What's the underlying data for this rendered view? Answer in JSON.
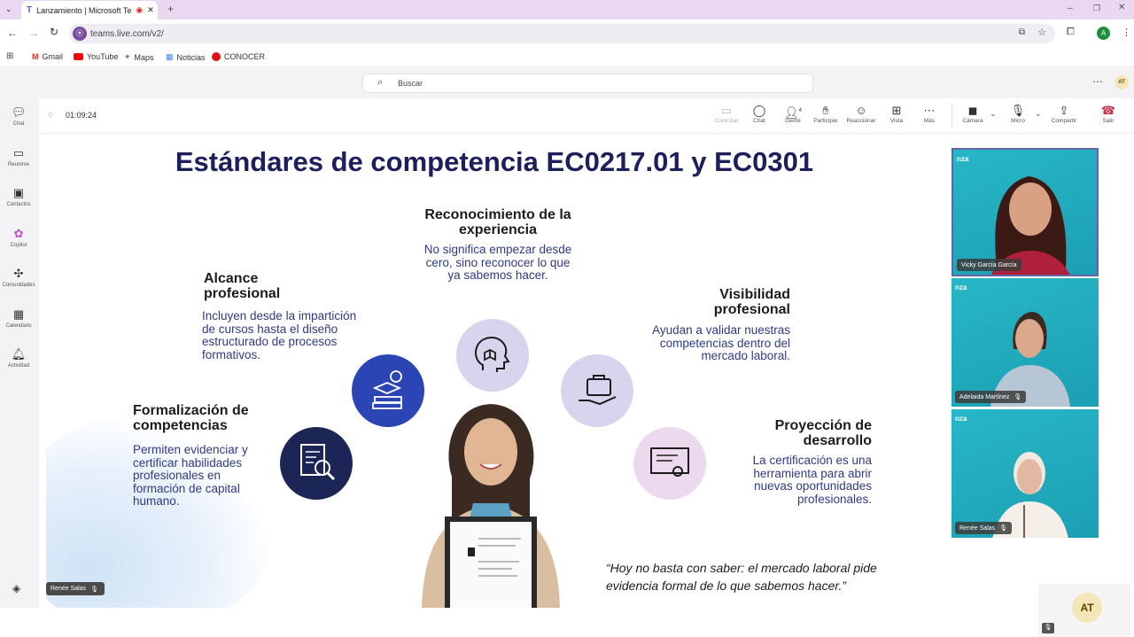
{
  "browser": {
    "tab_title": "Lanzamiento | Microsoft Te",
    "url": "teams.live.com/v2/",
    "bookmarks": [
      {
        "label": "Gmail",
        "icon": "gmail-icon"
      },
      {
        "label": "YouTube",
        "icon": "youtube-icon"
      },
      {
        "label": "Maps",
        "icon": "maps-icon"
      },
      {
        "label": "Noticias",
        "icon": "news-icon"
      },
      {
        "label": "CONOCER",
        "icon": "conocer-icon"
      }
    ],
    "profile_initial": "A"
  },
  "teams": {
    "search_placeholder": "Buscar",
    "user_initials": "AT",
    "rail": [
      {
        "label": "Chat",
        "icon": "chat-icon"
      },
      {
        "label": "Reunirse",
        "icon": "video-icon"
      },
      {
        "label": "Contactos",
        "icon": "contacts-icon"
      },
      {
        "label": "Copilot",
        "icon": "copilot-icon"
      },
      {
        "label": "Comunidades",
        "icon": "communities-icon"
      },
      {
        "label": "Calendario",
        "icon": "calendar-icon"
      },
      {
        "label": "Actividad",
        "icon": "bell-icon"
      }
    ]
  },
  "meeting": {
    "timer": "01:09:24",
    "toolbar": {
      "control": "Controlar",
      "chat": "Chat",
      "people": "Gente",
      "people_count": "4",
      "raise": "Participar",
      "react": "Reaccionar",
      "view": "Vista",
      "more": "Más",
      "camera": "Cámara",
      "mic": "Micro",
      "share": "Compartir",
      "leave": "Salir"
    },
    "presenter": "Renée Salas",
    "participants": [
      {
        "name": "Vicky García García"
      },
      {
        "name": "Adelaida Martínez"
      },
      {
        "name": "Renée Salas"
      }
    ],
    "self_initials": "AT"
  },
  "slide": {
    "title": "Estándares de competencia EC0217.01 y EC0301",
    "items": [
      {
        "heading": "Reconocimiento de la experiencia",
        "body": "No significa empezar desde cero, sino reconocer lo que ya sabemos hacer."
      },
      {
        "heading": "Alcance profesional",
        "body": "Incluyen desde la impartición de cursos hasta el diseño estructurado de procesos formativos."
      },
      {
        "heading": "Visibilidad profesional",
        "body": "Ayudan a validar nuestras competencias dentro del mercado laboral."
      },
      {
        "heading": "Formalización de competencias",
        "body": "Permiten evidenciar y certificar habilidades profesionales en formación de capital humano."
      },
      {
        "heading": "Proyección de desarrollo",
        "body": "La certificación es una herramienta para abrir nuevas oportunidades profesionales."
      }
    ],
    "quote": "“Hoy no basta con saber: el mercado laboral pide evidencia formal de lo que sabemos hacer.”",
    "colors": {
      "title": "#1c1f5c",
      "body": "#2f3b84",
      "navy": "#1b2656",
      "blue": "#2b45b5",
      "lavender": "#d9d3ee",
      "pink": "#ecd9ee"
    }
  }
}
